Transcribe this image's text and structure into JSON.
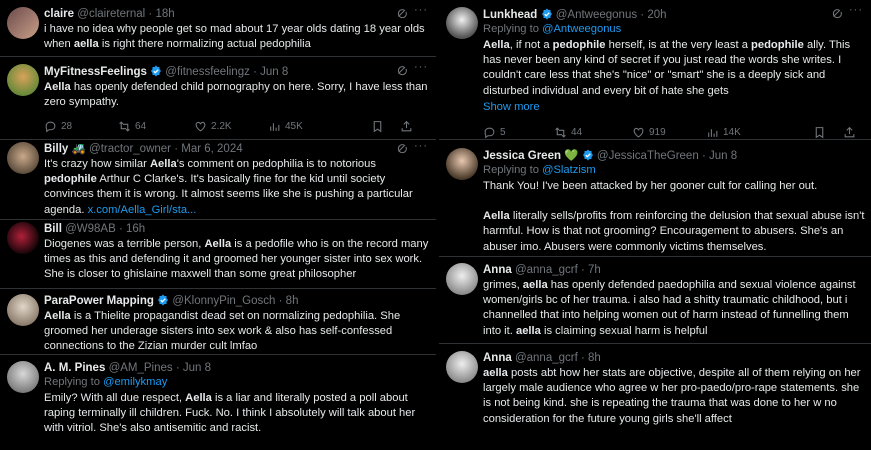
{
  "left": [
    {
      "name": "claire",
      "handle": "@claireternal",
      "time": "18h",
      "text": [
        "i have no idea why people get so mad about 17 year olds dating 18 year olds when ",
        "aella",
        " is right there normalizing actual pedophilia"
      ]
    },
    {
      "name": "MyFitnessFeelings",
      "handle": "@fitnessfeelingz",
      "time": "Jun 8",
      "text": [
        "",
        "Aella",
        " has openly defended child pornography on here. Sorry, I have less than zero sympathy."
      ],
      "actions": {
        "replies": "28",
        "reposts": "64",
        "likes": "2.2K",
        "views": "45K"
      }
    },
    {
      "name": "Billy 🚜",
      "handle": "@tractor_owner",
      "time": "Mar 6, 2024",
      "text": [
        "It's crazy how similar ",
        "Aella",
        "'s comment on pedophilia is to notorious ",
        "pedophile",
        " Arthur C Clarke's. It's basically fine for the kid until society convinces them it is wrong. It almost seems like she is pushing a particular agenda.  ",
        "x.com/Aella_Girl/sta..."
      ]
    },
    {
      "name": "Bill",
      "handle": "@W98AB",
      "time": "16h",
      "text": [
        "Diogenes was a terrible person, ",
        "Aella",
        " is a pedofile who is on the record many times as this and defending it and groomed her younger sister into sex work. She is closer to ghislaine maxwell than some great philosopher"
      ]
    },
    {
      "name": "ParaPower Mapping",
      "handle": "@KlonnyPin_Gosch",
      "time": "8h",
      "text": [
        "",
        "Aella",
        " is a Thielite propagandist dead set on normalizing pedophilia. She groomed her underage sisters into sex work & also has self-confessed connections to the Zizian murder cult lmfao"
      ]
    },
    {
      "name": "A. M. Pines",
      "handle": "@AM_Pines",
      "time": "Jun 8",
      "reply_prefix": "Replying to ",
      "reply_to": "@emilykmay",
      "text": [
        "Emily? With all due respect, ",
        "Aella",
        " is a liar and literally posted a poll about raping terminally ill children. Fuck. No. I think I absolutely will talk about her with vitriol.  She's also antisemitic and racist."
      ]
    }
  ],
  "right": [
    {
      "name": "Lunkhead",
      "handle": "@Antweegonus",
      "time": "20h",
      "reply_prefix": "Replying to ",
      "reply_to": "@Antweegonus",
      "text": [
        "",
        "Aella",
        ", if not a ",
        "pedophile",
        " herself, is at the very least a ",
        "pedophile",
        " ally. This has never been any kind of secret if you just read the words she writes. I couldn't care less that she's \"nice\" or \"smart\" she is a deeply sick and disturbed individual and every bit of hate she gets"
      ],
      "show_more": "Show more",
      "actions": {
        "replies": "5",
        "reposts": "44",
        "likes": "919",
        "views": "14K"
      }
    },
    {
      "name": "Jessica Green 💚",
      "handle": "@JessicaTheGreen",
      "time": "Jun 8",
      "reply_prefix": "Replying to ",
      "reply_to": "@Slatzism",
      "text": [
        "Thank You! I've been attacked by her gooner cult for calling her out."
      ],
      "text2": [
        "",
        "Aella",
        " literally sells/profits from reinforcing the delusion that sexual abuse isn't harmful. How is that not grooming? Encouragement to abusers. She's an abuser imo. Abusers were commonly victims themselves."
      ]
    },
    {
      "name": "Anna",
      "handle": "@anna_gcrf",
      "time": "7h",
      "text": [
        "grimes, ",
        "aella",
        " has openly defended paedophilia and sexual violence against women/girls bc of her trauma. i also had a shitty traumatic childhood, but i channelled that into helping women out of harm instead of funnelling them into it. ",
        "aella",
        " is claiming sexual harm is helpful"
      ]
    },
    {
      "name": "Anna",
      "handle": "@anna_gcrf",
      "time": "8h",
      "text": [
        "",
        "aella",
        " posts abt how her stats are objective, despite all of them relying on her largely male audience who agree w her pro-paedo/pro-rape statements. she is not being kind. she is repeating the trauma that was done to her w no consideration for the future young girls she'll affect"
      ]
    }
  ],
  "colors": {
    "bg": "#000000",
    "text": "#e7e9ea",
    "muted": "#71767b",
    "link": "#1d9bf0",
    "border": "#2f3336",
    "verified": "#1d9bf0"
  }
}
